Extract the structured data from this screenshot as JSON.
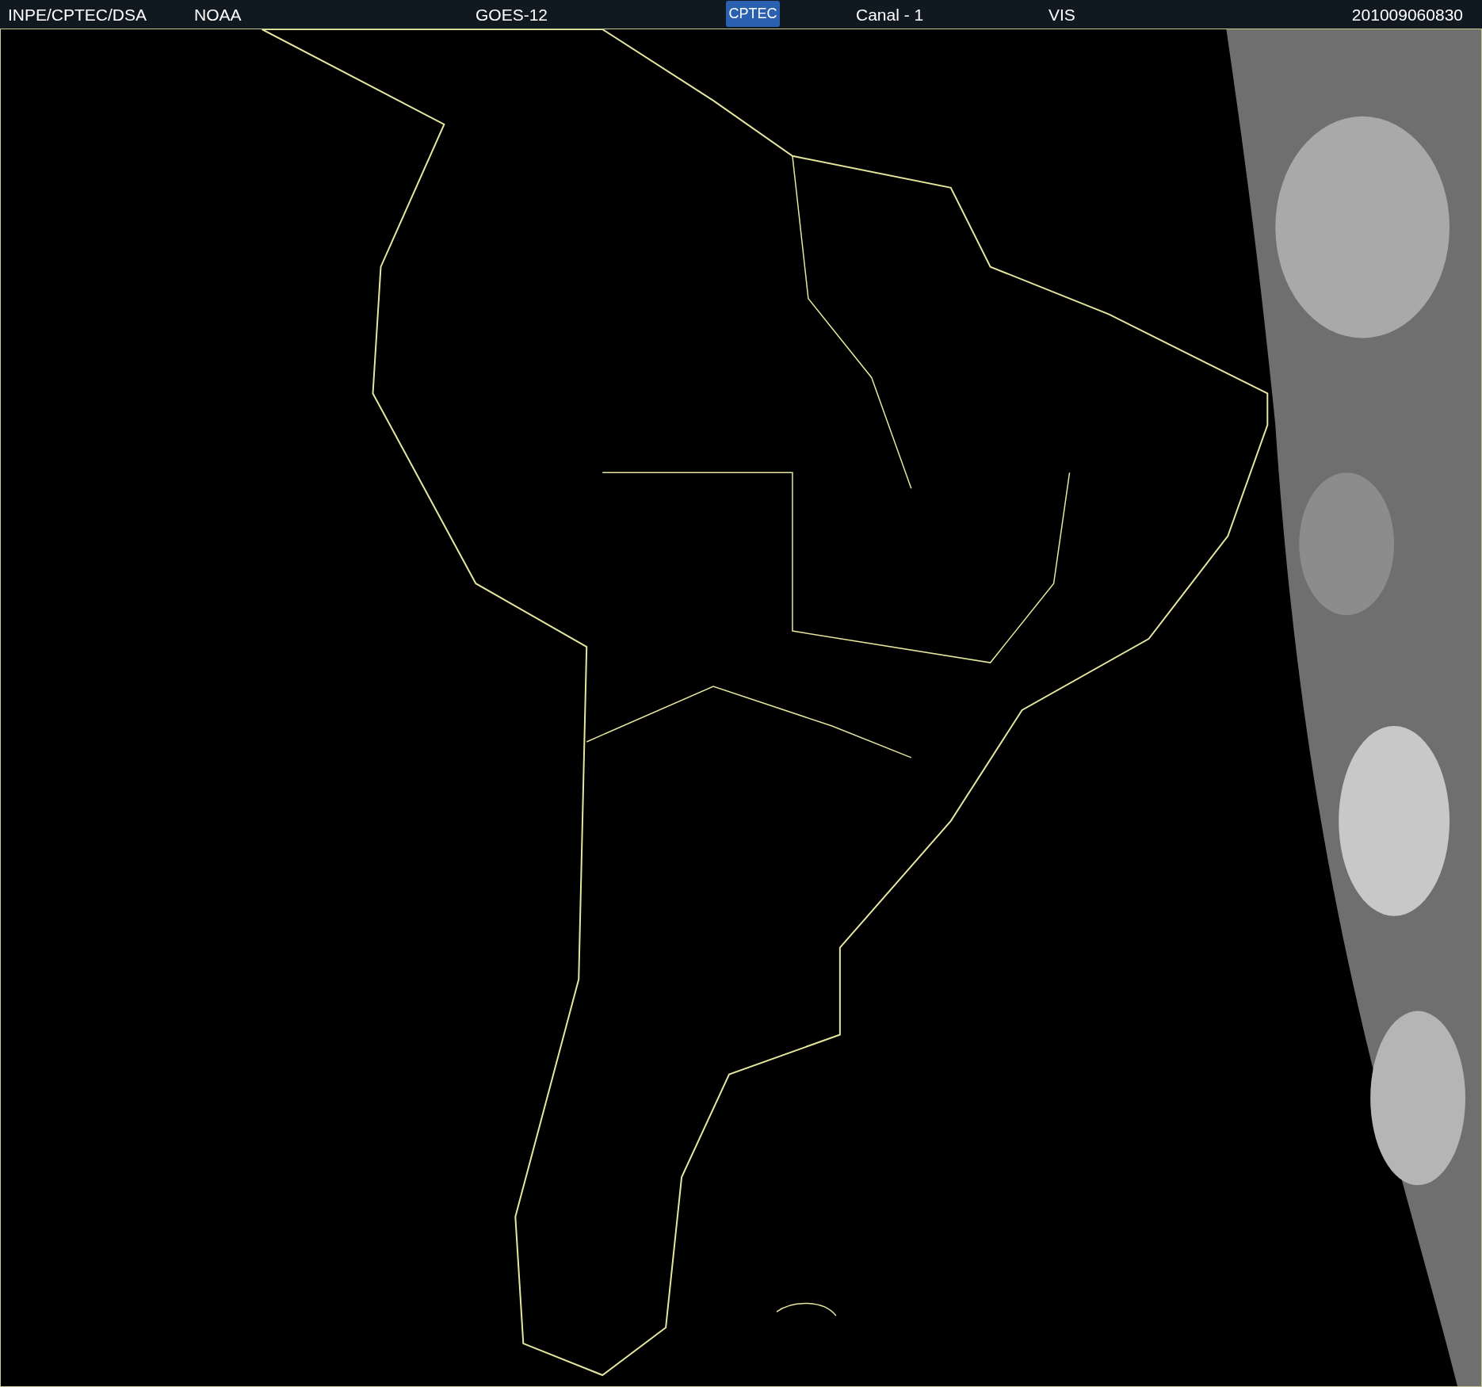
{
  "header": {
    "source": "INPE/CPTEC/DSA",
    "agency": "NOAA",
    "satellite": "GOES-12",
    "logo": "CPTEC",
    "channel": "Canal - 1",
    "band": "VIS",
    "timestamp": "201009060830"
  }
}
